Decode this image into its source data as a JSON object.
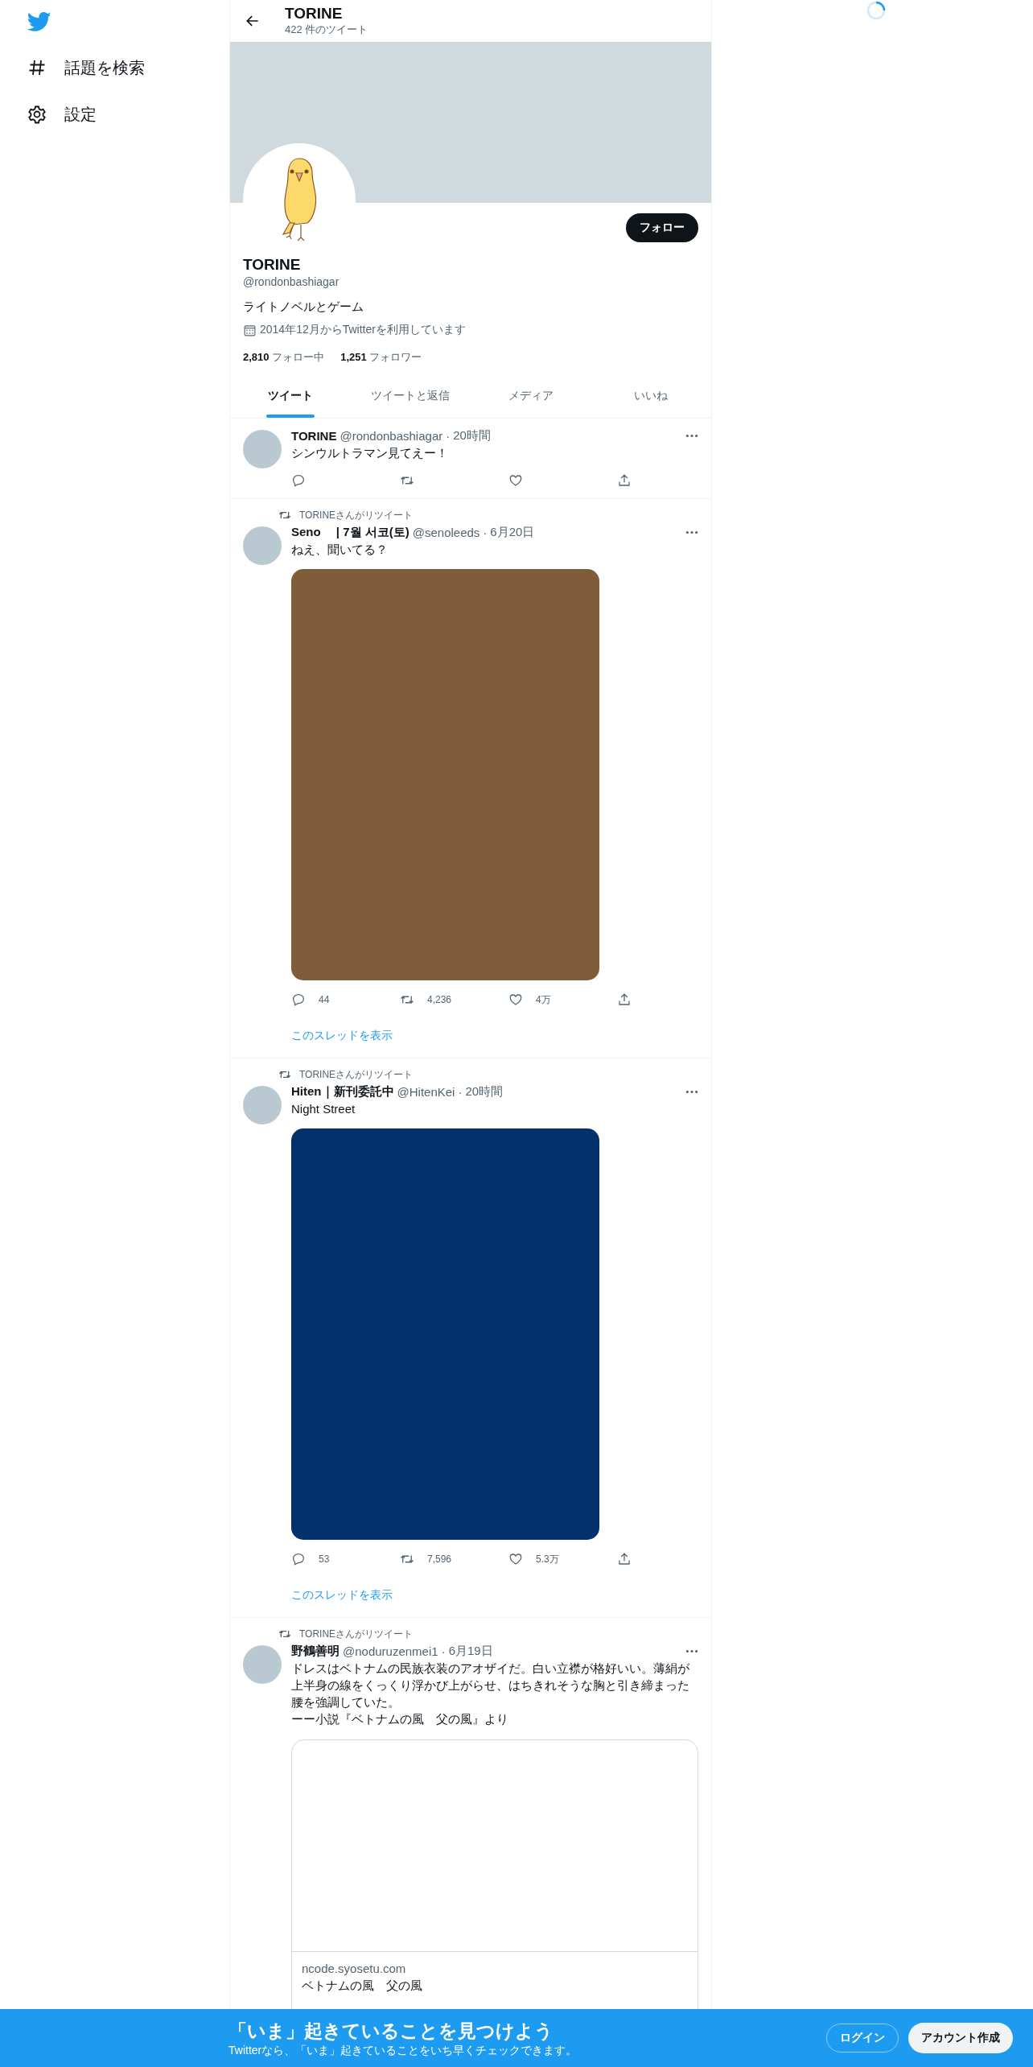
{
  "sidebar": {
    "items": [
      {
        "kind": "explore",
        "label": "話題を検索"
      },
      {
        "kind": "settings",
        "label": "設定"
      }
    ]
  },
  "header": {
    "title": "TORINE",
    "subtitle": "422 件のツイート"
  },
  "profile": {
    "follow_button": "フォロー",
    "name": "TORINE",
    "handle": "@rondonbashiagar",
    "bio": "ライトノベルとゲーム",
    "joined": "2014年12月からTwitterを利用しています",
    "following_count": "2,810",
    "following_label": "フォロー中",
    "followers_count": "1,251",
    "followers_label": "フォロワー"
  },
  "tabs": [
    {
      "label": "ツイート",
      "selected": true
    },
    {
      "label": "ツイートと返信",
      "selected": false
    },
    {
      "label": "メディア",
      "selected": false
    },
    {
      "label": "いいね",
      "selected": false
    }
  ],
  "tweets": [
    {
      "name": "TORINE",
      "handle": "@rondonbashiagar",
      "dot": "·",
      "time": "20時間",
      "text": [
        "シンウルトラマン見てえー！"
      ]
    },
    {
      "retweeted_by": "TORINEさんがリツイート",
      "name": "Seno　 | 7월 서코(토)",
      "handle": "@senoleeds",
      "dot": "·",
      "time": "6月20日",
      "text": [
        "ねえ、聞いてる？"
      ],
      "media": {
        "kind": "picture",
        "color": "#7f5d3a"
      },
      "stats": {
        "replies": "44",
        "retweets": "4,236",
        "likes": "4万"
      },
      "show_thread": "このスレッドを表示"
    },
    {
      "retweeted_by": "TORINEさんがリツイート",
      "name": "Hiten｜新刊委託中",
      "handle": "@HitenKei",
      "dot": "·",
      "time": "20時間",
      "text": [
        "Night Street"
      ],
      "media": {
        "kind": "picture",
        "color": "#03316b"
      },
      "stats": {
        "replies": "53",
        "retweets": "7,596",
        "likes": "5.3万"
      },
      "show_thread": "このスレッドを表示"
    },
    {
      "retweeted_by": "TORINEさんがリツイート",
      "name": "野鶴善明",
      "handle": "@noduruzenmei1",
      "dot": "·",
      "time": "6月19日",
      "text": [
        "ドレスはベトナムの民族衣装のアオザイだ。白い立襟が格好いい。薄絹が上半身の線をくっくり浮かび上がらせ、はちきれそうな胸と引き締まった腰を強調していた。",
        "ーー小説『ベトナムの風　父の風』より"
      ],
      "card": {
        "domain": "ncode.syosetu.com",
        "title": "ベトナムの風　父の風"
      }
    }
  ],
  "signup_banner": {
    "title": "「いま」起きていることを見つけよう",
    "subtitle": "Twitterなら、「いま」起きていることをいち早くチェックできます。",
    "login": "ログイン",
    "signup": "アカウント作成"
  }
}
